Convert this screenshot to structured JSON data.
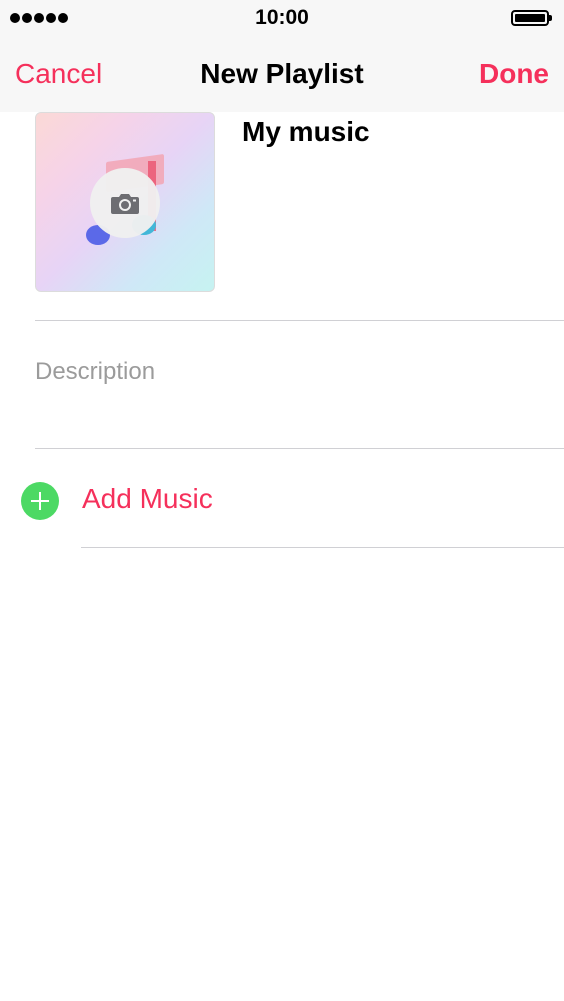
{
  "status_bar": {
    "time": "10:00",
    "signal_icon": "signal-dots-icon",
    "battery_icon": "battery-icon"
  },
  "nav": {
    "cancel_label": "Cancel",
    "title": "New Playlist",
    "done_label": "Done"
  },
  "playlist": {
    "name": "My music",
    "description_placeholder": "Description",
    "artwork_icon": "music-note-icon",
    "camera_icon": "camera-icon"
  },
  "actions": {
    "add_music_label": "Add Music",
    "add_icon": "plus-circle-icon"
  },
  "colors": {
    "accent": "#f5305b",
    "add_icon_green": "#4cd964",
    "placeholder_gray": "#9b9b9b",
    "bar_background": "#f7f7f7"
  }
}
